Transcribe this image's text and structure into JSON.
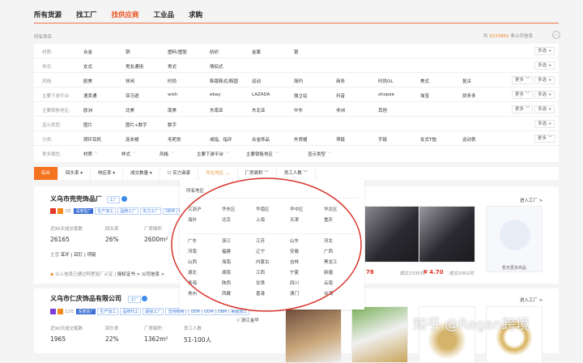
{
  "nav": {
    "items": [
      "所有货源",
      "找工厂",
      "找供应商",
      "工业品",
      "求购"
    ],
    "active": 2
  },
  "breadcrumb": "所有类目",
  "count": {
    "prefix": "共",
    "value": "5233862",
    "suffix": "条公司信息"
  },
  "filters": [
    {
      "label": "材质:",
      "values": [
        "合金",
        "铜",
        "塑料/塑胶",
        "纺织",
        "金属",
        "银"
      ],
      "more": false,
      "multi": "多选"
    },
    {
      "label": "样式:",
      "values": [
        "女式",
        "男女通用",
        "男式",
        "情侣式"
      ],
      "more": false,
      "multi": "多选"
    },
    {
      "label": "风格:",
      "values": [
        "欧美",
        "休闲",
        "时尚",
        "韩版韩式/韩国",
        "运动",
        "简约",
        "商务",
        "时尚OL",
        "美式",
        "复古"
      ],
      "more": "更多",
      "multi": "多选"
    },
    {
      "label": "主要下游平台:",
      "values": [
        "速卖通",
        "亚马逊",
        "wish",
        "ebay",
        "LAZADA",
        "独立站",
        "抖音",
        "shopee",
        "淘宝",
        "拼多多"
      ],
      "more": "更多",
      "multi": "多选"
    },
    {
      "label": "主要销售地区:",
      "values": [
        "欧洲",
        "北美",
        "南美",
        "东南亚",
        "东北亚",
        "中东",
        "非洲",
        "其他"
      ],
      "more": "更多",
      "multi": "多选"
    },
    {
      "label": "显示类型:",
      "values": [
        "图片",
        "图片+数字",
        "数字"
      ],
      "more": false,
      "multi": "多选"
    },
    {
      "label": "分类:",
      "values": [
        "颈环耳机",
        "连衣裙",
        "毛呢类",
        "戒指、指环",
        "合金饰品",
        "外贸裙",
        "项链",
        "手链",
        "女式T恤",
        "运动表"
      ],
      "more": "更多",
      "multi": false
    }
  ],
  "more_attrs": {
    "label": "更多属性:",
    "items": [
      "材质",
      "样式",
      "风格",
      "主要下游平台",
      "主要销售地区",
      "显示类型"
    ]
  },
  "sortbar": {
    "items": [
      "综合",
      "回头率",
      "响应率",
      "成交数量",
      "实力商家",
      "所在地区",
      "厂房面积",
      "员工人数"
    ]
  },
  "region_dropdown": {
    "all": "所有地区",
    "groups": [
      "江浙沪",
      "华东区",
      "华南区",
      "华中区",
      "华北区",
      "海外",
      "北京",
      "上海",
      "天津",
      "重庆"
    ],
    "provinces": [
      "广东",
      "浙江",
      "江苏",
      "山东",
      "河北",
      "河南",
      "福建",
      "辽宁",
      "安徽",
      "广西",
      "山西",
      "海南",
      "内蒙古",
      "吉林",
      "黑龙江",
      "湖北",
      "湖南",
      "江西",
      "宁夏",
      "新疆",
      "青海",
      "陕西",
      "甘肃",
      "四川",
      "云南",
      "贵州",
      "西藏",
      "香港",
      "澳门",
      "台湾"
    ]
  },
  "cards": [
    {
      "name": "义乌市兜兜饰品厂",
      "type": "工厂",
      "years": "3年",
      "tags": [
        "深度验厂",
        "生产加工",
        "品牌工厂",
        "实力工厂",
        "OEM | OE"
      ],
      "stats": [
        {
          "label": "近90天成交笔数",
          "value": "26165"
        },
        {
          "label": "回头率",
          "value": "26%"
        },
        {
          "label": "厂房面积",
          "value": "2600m²"
        }
      ],
      "main": "主营",
      "main_items": "耳环 | 耳钉 | 项链",
      "cert": "以上信息已通过阿里验厂认证 |",
      "cert_link": "授权证书 >",
      "company_link": "公司信息 >",
      "enter": "进入工厂 >",
      "products": [
        {
          "price": "78",
          "sold": "成交2335对"
        },
        {
          "price": "¥ 4.70",
          "sold": "成交2002对"
        }
      ],
      "empty": "暂无更多商品"
    },
    {
      "name": "义乌市仁庆饰品有限公司",
      "type": "工厂",
      "years": "12年",
      "tags": [
        "深度验厂",
        "生产加工",
        "品牌代工",
        "超级工厂",
        "支持刺绣",
        "OEM | ODM | OBM | 来图加工"
      ],
      "location": "浙江金华",
      "stats": [
        {
          "label": "近90天成交笔数",
          "value": "1965"
        },
        {
          "label": "回头率",
          "value": "22%"
        },
        {
          "label": "厂房面积",
          "value": "1362m²"
        },
        {
          "label": "员工人数",
          "value": "51-100人"
        }
      ],
      "enter": "进入工厂 >"
    }
  ],
  "watermark": "知乎 @Regan跨境"
}
